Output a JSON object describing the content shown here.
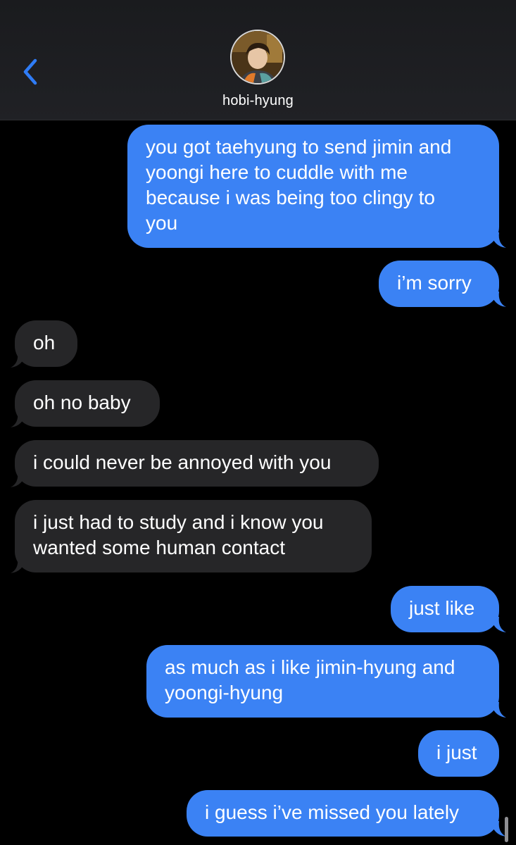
{
  "header": {
    "back_icon": "chevron-left-icon",
    "contact_name": "hobi-hyung",
    "accent": "#2f7cf6"
  },
  "colors": {
    "sent_bubble": "#3b82f4",
    "received_bubble": "#262628",
    "background": "#000000"
  },
  "messages": [
    {
      "sender": "me",
      "lines": [
        "you got taehyung to send jimin and",
        "yoongi here to cuddle with me",
        "because i was being too clingy to",
        "you"
      ]
    },
    {
      "sender": "me",
      "lines": [
        "i’m sorry"
      ]
    },
    {
      "sender": "them",
      "lines": [
        "oh"
      ]
    },
    {
      "sender": "them",
      "lines": [
        "oh no baby"
      ]
    },
    {
      "sender": "them",
      "lines": [
        "i could never be annoyed with you"
      ]
    },
    {
      "sender": "them",
      "lines": [
        "i just had to study and i know you",
        "wanted some human contact"
      ]
    },
    {
      "sender": "me",
      "lines": [
        "just like"
      ]
    },
    {
      "sender": "me",
      "lines": [
        "as much as i like jimin-hyung and",
        "yoongi-hyung"
      ]
    },
    {
      "sender": "me",
      "lines": [
        "i just"
      ]
    },
    {
      "sender": "me",
      "lines": [
        "i guess i’ve missed you lately"
      ]
    }
  ]
}
